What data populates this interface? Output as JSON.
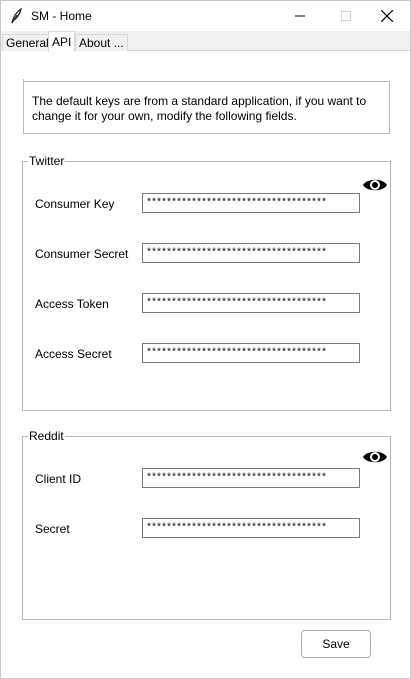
{
  "window": {
    "title": "SM - Home"
  },
  "tabs": [
    {
      "label": "General"
    },
    {
      "label": "API"
    },
    {
      "label": "About ..."
    }
  ],
  "active_tab": "API",
  "info": {
    "text": "The default keys are from a standard application, if you want to change it for your own, modify the following fields."
  },
  "twitter": {
    "title": "Twitter",
    "toggle_icon": "eye-icon",
    "fields": [
      {
        "label": "Consumer Key",
        "value": "************************************"
      },
      {
        "label": "Consumer Secret",
        "value": "************************************"
      },
      {
        "label": "Access Token",
        "value": "************************************"
      },
      {
        "label": "Access Secret",
        "value": "************************************"
      }
    ]
  },
  "reddit": {
    "title": "Reddit",
    "toggle_icon": "eye-icon",
    "fields": [
      {
        "label": "Client ID",
        "value": "************************************"
      },
      {
        "label": "Secret",
        "value": "************************************"
      }
    ]
  },
  "actions": {
    "save_label": "Save"
  }
}
